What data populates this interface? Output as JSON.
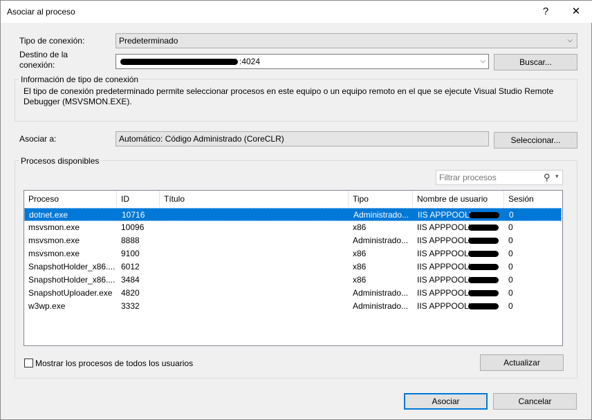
{
  "window": {
    "title": "Asociar al proceso",
    "help": "?",
    "close": "✕"
  },
  "connection_type": {
    "label": "Tipo de conexión:",
    "value": "Predeterminado"
  },
  "connection_target": {
    "label_line1": "Destino de la",
    "label_line2": "conexión:",
    "value_suffix": ":4024",
    "browse_button": "Buscar..."
  },
  "info": {
    "title": "Información de tipo de conexión",
    "text_line1": "El tipo de conexión predeterminado permite seleccionar procesos en este equipo o un equipo remoto en el que se ejecute Visual Studio Remote",
    "text_line2": "Debugger (MSVSMON.EXE)."
  },
  "attach_to": {
    "label": "Asociar a:",
    "value": "Automático: Código Administrado (CoreCLR)",
    "select_button": "Seleccionar..."
  },
  "processes": {
    "title": "Procesos disponibles",
    "filter_placeholder": "Filtrar procesos",
    "columns": [
      "Proceso",
      "ID",
      "Título",
      "Tipo",
      "Nombre de usuario",
      "Sesión"
    ],
    "rows": [
      {
        "name": "dotnet.exe",
        "id": "10716",
        "title": "",
        "type": "Administrado...",
        "user": "IIS APPPOOL\\",
        "session": "0",
        "selected": true
      },
      {
        "name": "msvsmon.exe",
        "id": "10096",
        "title": "",
        "type": "x86",
        "user": "IIS APPPOOL\\",
        "session": "0"
      },
      {
        "name": "msvsmon.exe",
        "id": "8888",
        "title": "",
        "type": "Administrado...",
        "user": "IIS APPPOOL\\",
        "session": "0"
      },
      {
        "name": "msvsmon.exe",
        "id": "9100",
        "title": "",
        "type": "x86",
        "user": "IIS APPPOOL\\",
        "session": "0"
      },
      {
        "name": "SnapshotHolder_x86....",
        "id": "6012",
        "title": "",
        "type": "x86",
        "user": "IIS APPPOOL\\",
        "session": "0"
      },
      {
        "name": "SnapshotHolder_x86....",
        "id": "3484",
        "title": "",
        "type": "x86",
        "user": "IIS APPPOOL\\",
        "session": "0"
      },
      {
        "name": "SnapshotUploader.exe",
        "id": "4820",
        "title": "",
        "type": "Administrado...",
        "user": "IIS APPPOOL\\",
        "session": "0"
      },
      {
        "name": "w3wp.exe",
        "id": "3332",
        "title": "",
        "type": "Administrado...",
        "user": "IIS APPPOOL\\",
        "session": "0"
      }
    ],
    "show_all_users": "Mostrar los procesos de todos los usuarios",
    "refresh_button": "Actualizar"
  },
  "footer": {
    "attach_button": "Asociar",
    "cancel_button": "Cancelar"
  },
  "colors": {
    "accent": "#0078d7",
    "background": "#f0f0f0"
  }
}
